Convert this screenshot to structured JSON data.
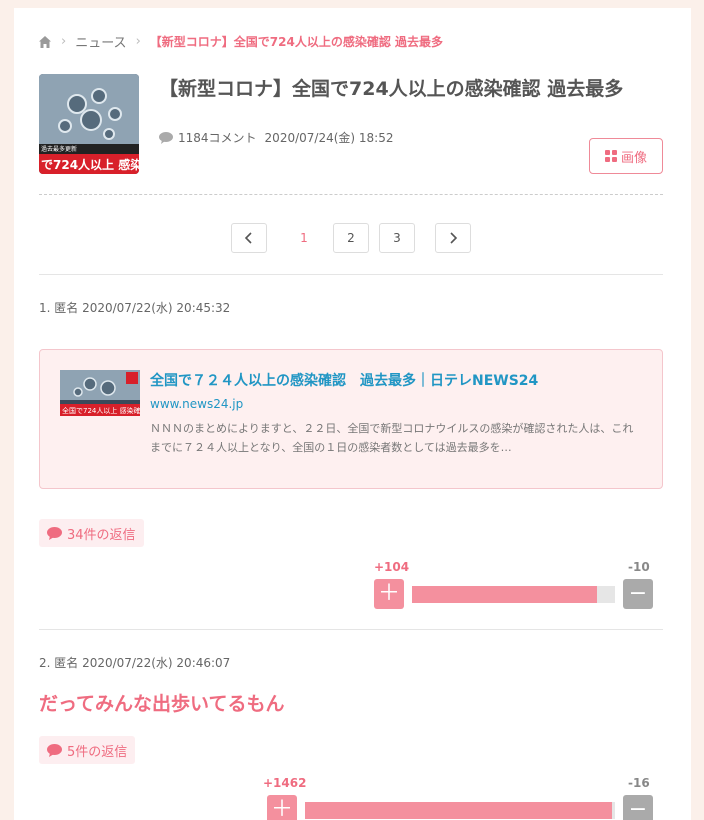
{
  "breadcrumb": {
    "home_icon": "home-icon",
    "items": [
      "ニュース",
      "【新型コロナ】全国で724人以上の感染確認 過去最多"
    ]
  },
  "article": {
    "thumb_caption": "で724人以上 感染",
    "thumb_small": "過去最多更新",
    "title": "【新型コロナ】全国で724人以上の感染確認 過去最多",
    "comment_count": "1184コメント",
    "date": "2020/07/24(金) 18:52",
    "image_button": "画像"
  },
  "pagination": {
    "prev_icon": "chevron-left-icon",
    "pages": [
      "1",
      "2",
      "3"
    ],
    "current": "1",
    "next_icon": "chevron-right-icon"
  },
  "comments": [
    {
      "header": "1. 匿名 2020/07/22(水) 20:45:32",
      "link": {
        "title": "全国で７２４人以上の感染確認　過去最多｜日テレNEWS24",
        "url": "www.news24.jp",
        "desc": "ＮＮＮのまとめによりますと、２２日、全国で新型コロナウイルスの感染が確認された人は、これまでに７２４人以上となり、全国の１日の感染者数としては過去最多を…",
        "thumb_caption": "全国で724人以上 感染確認"
      },
      "replies": "34件の返信",
      "plus": "+104",
      "minus": "-10",
      "ratio": 0.91
    },
    {
      "header": "2. 匿名 2020/07/22(水) 20:46:07",
      "body": "だってみんな出歩いてるもん",
      "replies": "5件の返信",
      "plus": "+1462",
      "minus": "-16",
      "ratio": 0.99
    }
  ],
  "colors": {
    "accent": "#ef6c80",
    "link": "#2196c4",
    "plus_bar": "#f4909e",
    "minus_button": "#aaaaaa"
  }
}
